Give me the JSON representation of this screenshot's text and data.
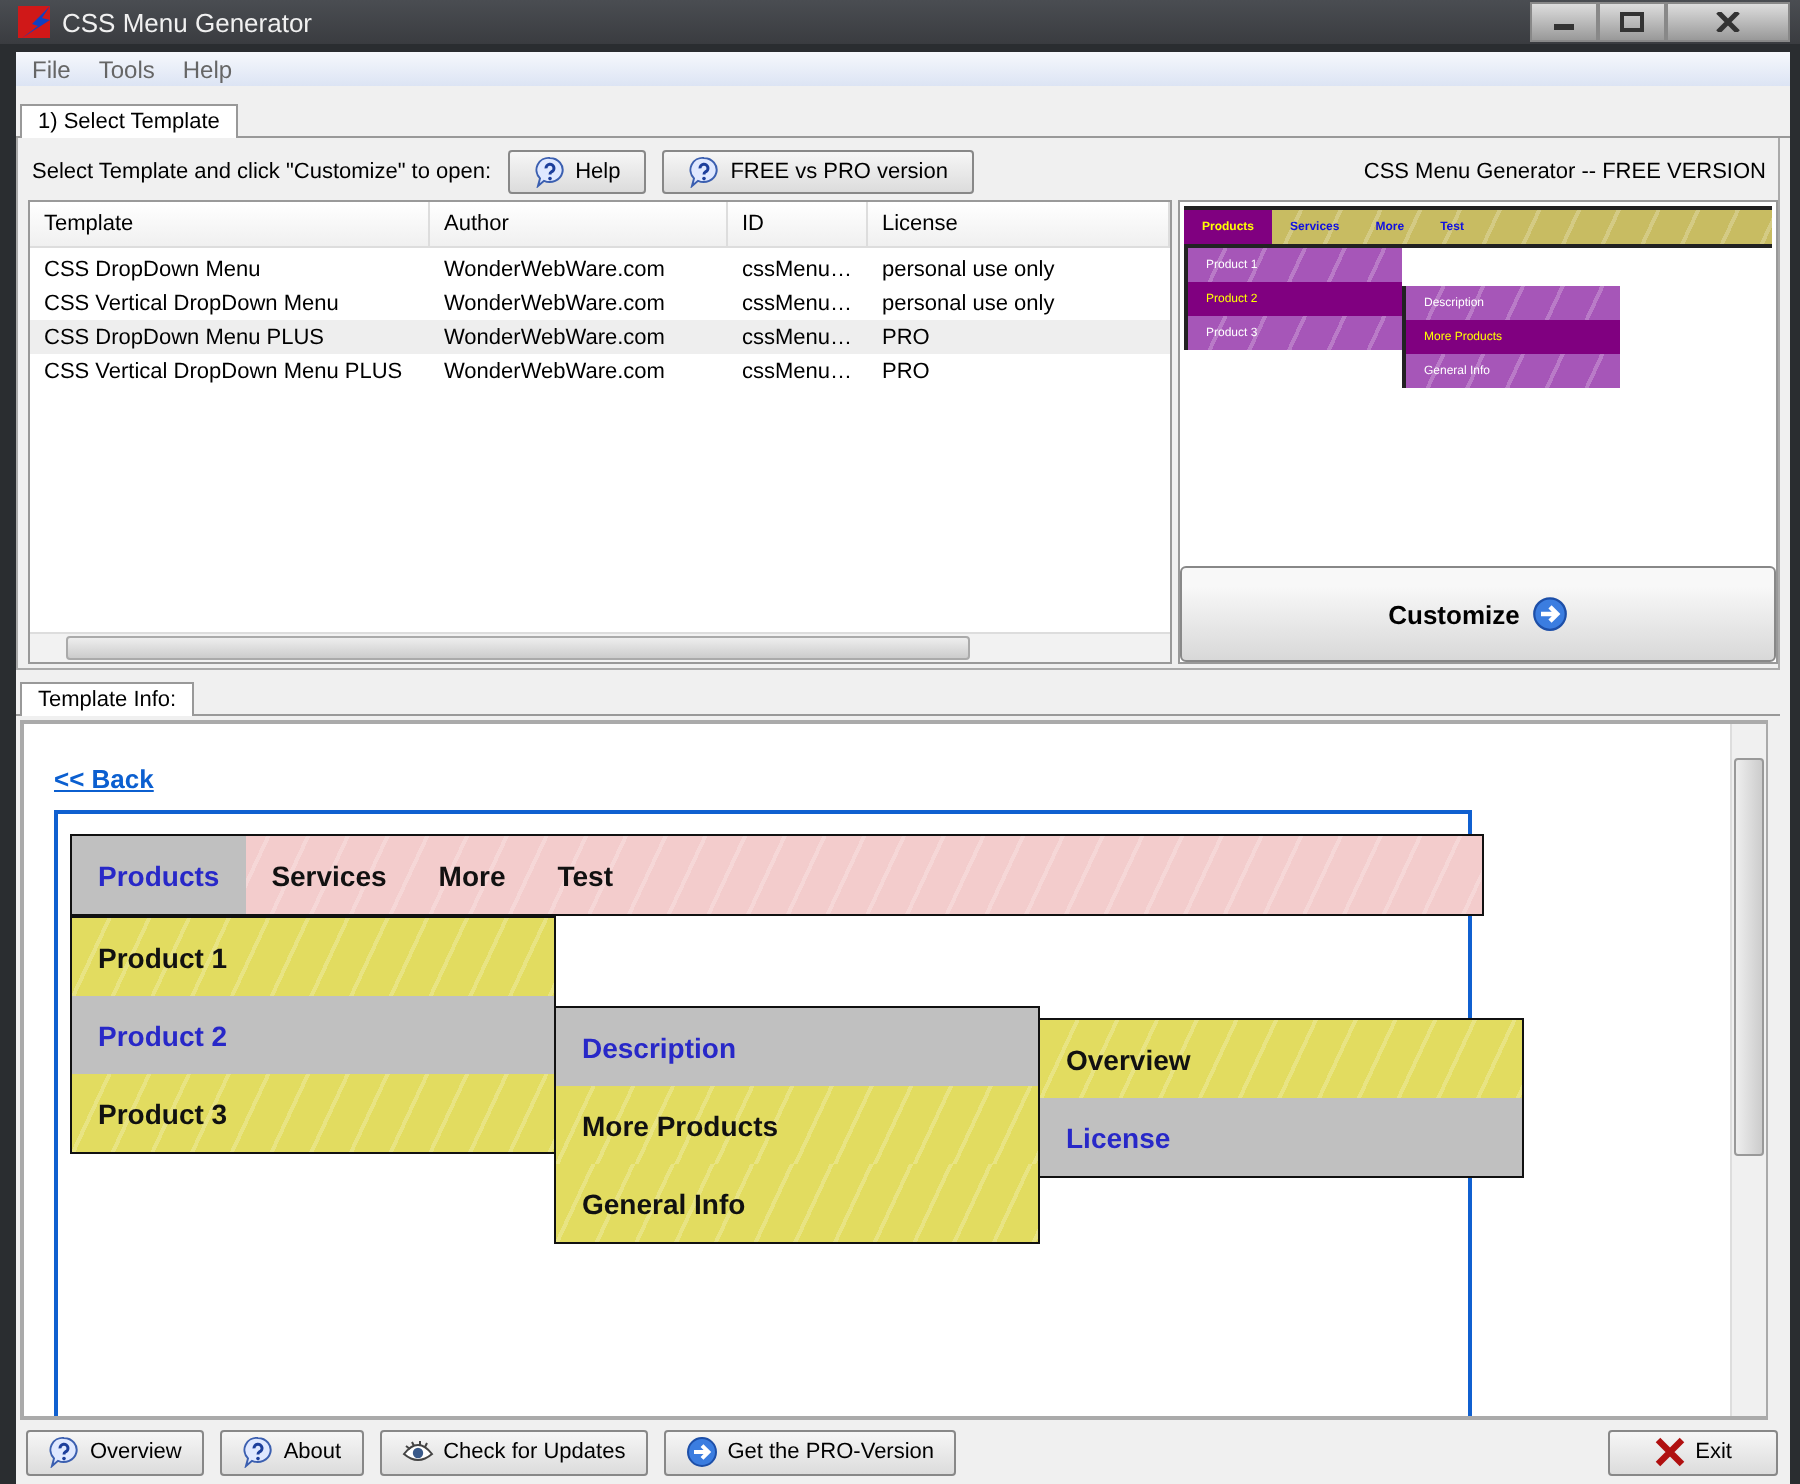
{
  "window": {
    "title": "CSS Menu Generator"
  },
  "menu": [
    "File",
    "Tools",
    "Help"
  ],
  "tabs": [
    {
      "label": "1) Select Template",
      "selected": true
    }
  ],
  "toolbar": {
    "prompt": "Select Template and click \"Customize\" to open:",
    "buttons": [
      {
        "label": "Help",
        "kind": "help"
      },
      {
        "label": "FREE vs PRO version",
        "kind": "help"
      }
    ],
    "version": "CSS Menu Generator -- FREE VERSION"
  },
  "table": {
    "columns": [
      "Template",
      "Author",
      "ID",
      "License"
    ],
    "rows": [
      {
        "cells": [
          "CSS DropDown Menu",
          "WonderWebWare.com",
          "cssMenu…",
          "personal use only"
        ],
        "selected": false
      },
      {
        "cells": [
          "CSS Vertical DropDown Menu",
          "WonderWebWare.com",
          "cssMenu…",
          "personal use only"
        ],
        "selected": false
      },
      {
        "cells": [
          "CSS DropDown Menu PLUS",
          "WonderWebWare.com",
          "cssMenu…",
          "PRO"
        ],
        "selected": true
      },
      {
        "cells": [
          "CSS Vertical DropDown Menu PLUS",
          "WonderWebWare.com",
          "cssMenu…",
          "PRO"
        ],
        "selected": false
      }
    ]
  },
  "preview": {
    "menu": [
      {
        "label": "Products",
        "selected": true,
        "children": [
          {
            "label": "Product 1",
            "selected": false
          },
          {
            "label": "Product 2",
            "selected": true,
            "children": [
              {
                "label": "Description",
                "selected": false
              },
              {
                "label": "More Products",
                "selected": true
              },
              {
                "label": "General Info",
                "selected": false
              }
            ]
          },
          {
            "label": "Product 3",
            "selected": false
          }
        ]
      },
      {
        "label": "Services",
        "selected": false
      },
      {
        "label": "More",
        "selected": false
      },
      {
        "label": "Test",
        "selected": false
      }
    ]
  },
  "customize_button": "Customize",
  "info_tabs": [
    {
      "label": "Template Info:",
      "selected": true
    }
  ],
  "info": {
    "back_link": "<< Back",
    "menu": [
      {
        "label": "Products",
        "selected": true,
        "children": [
          {
            "label": "Product 1",
            "selected": false
          },
          {
            "label": "Product 2",
            "selected": true,
            "children": [
              {
                "label": "Description",
                "selected": true,
                "children": [
                  {
                    "label": "Overview",
                    "selected": false
                  },
                  {
                    "label": "License",
                    "selected": true
                  }
                ]
              },
              {
                "label": "More Products",
                "selected": false
              },
              {
                "label": "General Info",
                "selected": false
              }
            ]
          },
          {
            "label": "Product 3",
            "selected": false
          }
        ]
      },
      {
        "label": "Services",
        "selected": false
      },
      {
        "label": "More",
        "selected": false
      },
      {
        "label": "Test",
        "selected": false
      }
    ]
  },
  "bottom_buttons": [
    {
      "label": "Overview",
      "kind": "help"
    },
    {
      "label": "About",
      "kind": "help"
    },
    {
      "label": "Check for Updates",
      "kind": "eye"
    },
    {
      "label": "Get the PRO-Version",
      "kind": "arrow"
    },
    {
      "label": "Exit",
      "kind": "exit"
    }
  ]
}
